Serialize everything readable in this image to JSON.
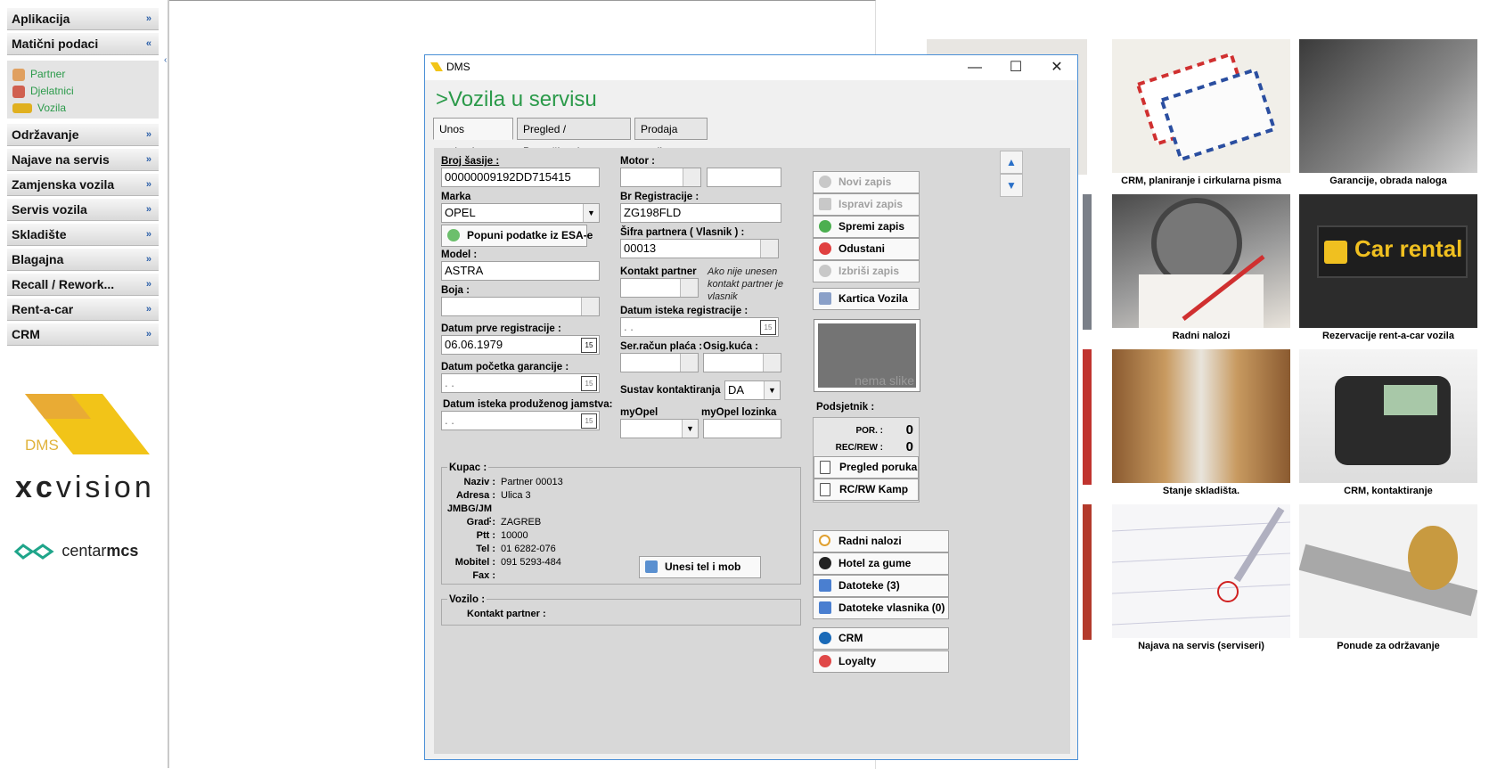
{
  "sidebar": {
    "menu": [
      {
        "label": "Aplikacija",
        "chevron": "»"
      },
      {
        "label": "Matični podaci",
        "chevron": "«"
      },
      {
        "label": "Održavanje",
        "chevron": "»"
      },
      {
        "label": "Najave na servis",
        "chevron": "»"
      },
      {
        "label": "Zamjenska vozila",
        "chevron": "»"
      },
      {
        "label": "Servis vozila",
        "chevron": "»"
      },
      {
        "label": "Skladište",
        "chevron": "»"
      },
      {
        "label": "Blagajna",
        "chevron": "»"
      },
      {
        "label": "Recall / Rework...",
        "chevron": "»"
      },
      {
        "label": "Rent-a-car",
        "chevron": "»"
      },
      {
        "label": "CRM",
        "chevron": "»"
      }
    ],
    "submenu": [
      {
        "label": "Partner",
        "icon": "person-icon"
      },
      {
        "label": "Djelatnici",
        "icon": "worker-icon"
      },
      {
        "label": "Vozila",
        "icon": "car-icon"
      }
    ],
    "logos": {
      "dms": "DMS",
      "xc": "xc",
      "vision": "vision",
      "centar": "centar",
      "mcs": "mcs"
    }
  },
  "tiles": [
    {
      "caption": "CRM, planiranje i cirkularna pisma"
    },
    {
      "caption": "Garancije, obrada naloga"
    },
    {
      "caption": "Radni nalozi"
    },
    {
      "caption": "Rezervacije rent-a-car vozila",
      "sign": "Car rental"
    },
    {
      "caption": "Stanje skladišta."
    },
    {
      "caption": "CRM, kontaktiranje"
    },
    {
      "caption": "Najava na servis (serviseri)"
    },
    {
      "caption": "Ponude za održavanje"
    }
  ],
  "window": {
    "title": "DMS",
    "controls": {
      "minimize": "—",
      "maximize": "☐",
      "close": "✕"
    },
    "form_title": ">Vozila u servisu",
    "tabs": [
      "Unos podataka",
      "Pregled / Pretraživanje",
      "Prodaja vozila"
    ],
    "fields": {
      "broj_sasije": {
        "label": "Broj šasije :",
        "value": "00000009192DD715415"
      },
      "marka": {
        "label": "Marka",
        "value": "OPEL"
      },
      "popuni_btn": "Popuni podatke iz ESA-e",
      "model": {
        "label": "Model :",
        "value": "ASTRA"
      },
      "boja": {
        "label": "Boja :",
        "value": ""
      },
      "datum_prve_reg": {
        "label": "Datum prve registracije :",
        "value": "06.06.1979"
      },
      "datum_pocetka_garancije": {
        "label": "Datum početka garancije :",
        "value": "  .  ."
      },
      "datum_isteka_jamstva": {
        "label": "Datum isteka produženog jamstva:",
        "value": "  .  ."
      },
      "motor": {
        "label": "Motor :"
      },
      "br_registracije": {
        "label": "Br Registracije :",
        "value": "ZG198FLD"
      },
      "sifra_partnera": {
        "label": "Šifra partnera ( Vlasnik ) :",
        "value": "00013"
      },
      "kontakt_partner": {
        "label": "Kontakt partner",
        "note": "Ako nije unesen kontakt partner je vlasnik"
      },
      "datum_isteka_reg": {
        "label": "Datum isteka registracije :",
        "value": "  .  ."
      },
      "ser_racun_placa": {
        "label": "Ser.račun plaća :"
      },
      "osig_kuca": {
        "label": "Osig.kuća :"
      },
      "sustav_kontaktiranja": {
        "label": "Sustav kontaktiranja",
        "value": "DA"
      },
      "myopel": {
        "label": "myOpel"
      },
      "myopel_lozinka": {
        "label": "myOpel lozinka"
      }
    },
    "kupac": {
      "title": "Kupac :",
      "rows": [
        {
          "label": "Naziv :",
          "value": "Partner 00013"
        },
        {
          "label": "Adresa :",
          "value": "Ulica 3"
        },
        {
          "label": "JMBG/JM :",
          "value": ""
        },
        {
          "label": "Grad :",
          "value": "ZAGREB"
        },
        {
          "label": "Ptt :",
          "value": "10000"
        },
        {
          "label": "Tel :",
          "value": "01 6282-076"
        },
        {
          "label": "Mobitel :",
          "value": "091 5293-484"
        },
        {
          "label": "Fax :",
          "value": ""
        }
      ],
      "unesi_btn": "Unesi tel i mob"
    },
    "vozilo": {
      "title": "Vozilo :",
      "kontakt_label": "Kontakt partner :"
    },
    "actions": {
      "novi": "Novi zapis",
      "ispravi": "Ispravi zapis",
      "spremi": "Spremi zapis",
      "odustani": "Odustani",
      "izbrisi": "Izbriši zapis",
      "kartica": "Kartica Vozila"
    },
    "photo_placeholder": "nema slike",
    "podsjetnik": {
      "title": "Podsjetnik :",
      "por_label": "POR. :",
      "por_value": "0",
      "recrew_label": "REC/REW :",
      "recrew_value": "0",
      "pregled": "Pregled poruka",
      "rcrw": "RC/RW Kamp"
    },
    "links": [
      "Radni nalozi",
      "Hotel za gume",
      "Datoteke (3)",
      "Datoteke vlasnika (0)"
    ],
    "crm": [
      "CRM",
      "Loyalty"
    ]
  },
  "colors": {
    "accent_green": "#2b9a4a",
    "window_border": "#4a8fd6",
    "logo_yellow": "#f2c418"
  }
}
